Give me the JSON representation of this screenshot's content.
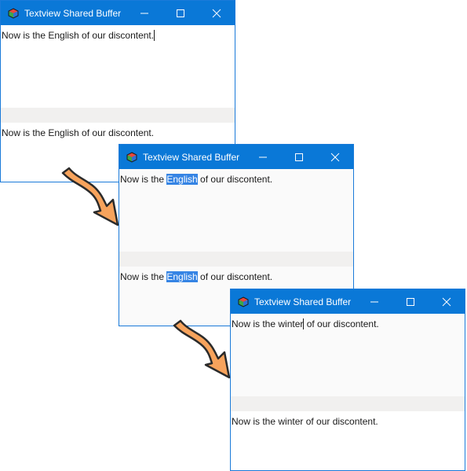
{
  "windows": [
    {
      "title": "Textview Shared Buffer",
      "top_text": "Now is the English of our discontent.",
      "bottom_text": "Now is the English of our discontent."
    },
    {
      "title": "Textview Shared Buffer",
      "top_text": {
        "before": "Now is the ",
        "selected": "English",
        "after": " of our discontent."
      },
      "bottom_text": {
        "before": "Now is the ",
        "selected": "English",
        "after": " of our discontent."
      }
    },
    {
      "title": "Textview Shared Buffer",
      "top_text": {
        "before": "Now is the winter",
        "after": " of our discontent."
      },
      "bottom_text": "Now is the winter of our discontent."
    }
  ],
  "icons": {
    "app": "cube-icon",
    "minimize": "minimize-icon",
    "maximize": "maximize-icon",
    "close": "close-icon",
    "flow_arrow": "curved-arrow-icon"
  },
  "colors": {
    "titlebar": "#0a78d7",
    "selection": "#3584e4",
    "arrow_fill": "#f7a35c",
    "arrow_stroke": "#2b2b2b"
  }
}
